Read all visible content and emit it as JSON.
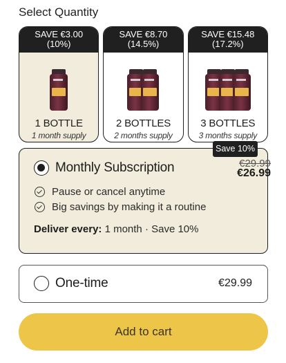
{
  "section_title": "Select Quantity",
  "quantity_options": [
    {
      "save_line1": "SAVE €3.00",
      "save_line2": "(10%)",
      "name": "1 BOTTLE",
      "supply": "1 month supply",
      "bottles": 1,
      "selected": true
    },
    {
      "save_line1": "SAVE €8.70",
      "save_line2": "(14.5%)",
      "name": "2 BOTTLES",
      "supply": "2 months supply",
      "bottles": 2,
      "selected": false
    },
    {
      "save_line1": "SAVE €15.48",
      "save_line2": "(17.2%)",
      "name": "3 BOTTLES",
      "supply": "3 months supply",
      "bottles": 3,
      "selected": false
    }
  ],
  "subscription": {
    "badge": "Save 10%",
    "title": "Monthly Subscription",
    "old_price": "€29.99",
    "new_price": "€26.99",
    "selected": true,
    "benefits": [
      "Pause or cancel anytime",
      "Big savings by making it a routine"
    ],
    "deliver_label": "Deliver every:",
    "deliver_value": "1 month · Save 10%"
  },
  "one_time": {
    "title": "One-time",
    "price": "€29.99",
    "selected": false
  },
  "add_to_cart_label": "Add to cart",
  "colors": {
    "accent_yellow": "#edc549",
    "selected_bg": "#f1ecdb",
    "dark": "#202020"
  }
}
